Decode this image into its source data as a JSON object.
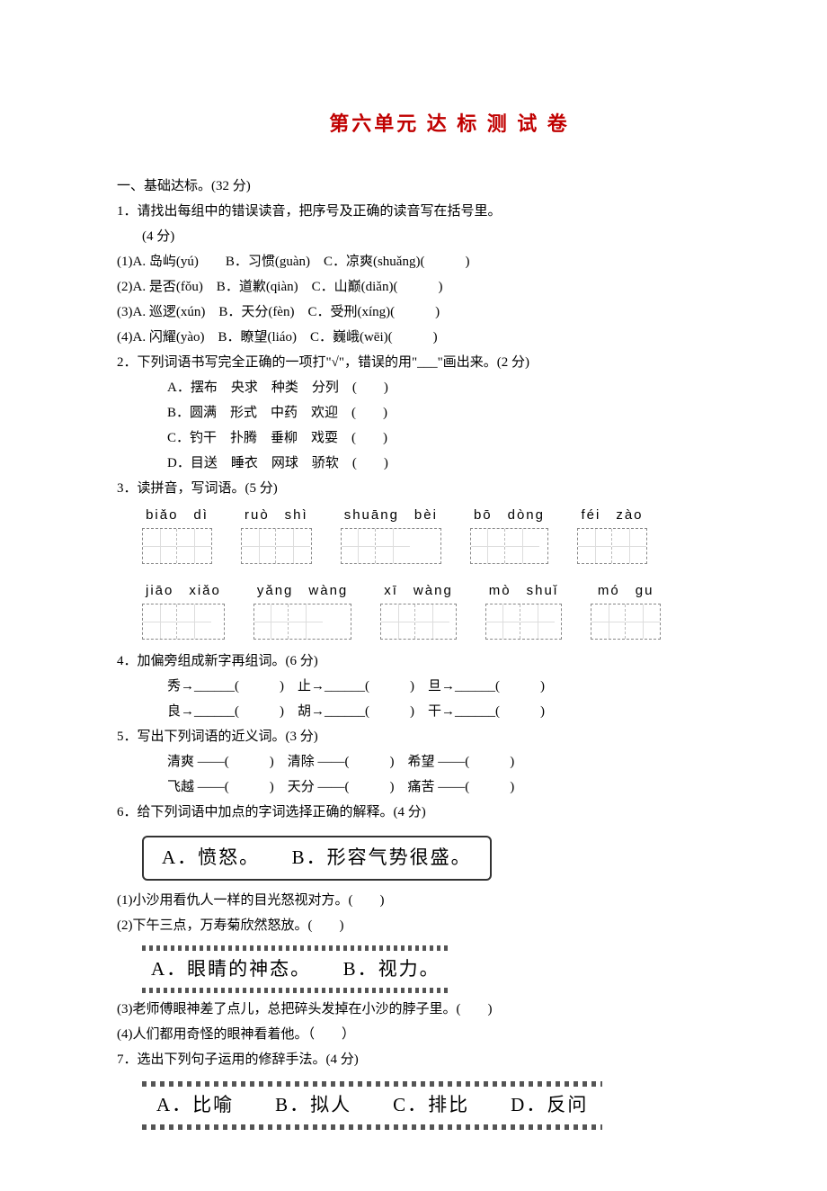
{
  "title": "第六单元 达 标 测 试 卷",
  "section1": {
    "header": "一、基础达标。(32 分)",
    "q1": {
      "stem": "1．请找出每组中的错误读音，把序号及正确的读音写在括号里。",
      "pts": "(4 分)",
      "rows": [
        "(1)A. 岛屿(yú)　　B．习惯(guàn)　C．凉爽(shuǎng)(　　　)",
        "(2)A. 是否(fǒu)　B．道歉(qiàn)　C．山巅(diǎn)(　　　)",
        "(3)A. 巡逻(xún)　B．天分(fèn)　C．受刑(xíng)(　　　)",
        "(4)A. 闪耀(yào)　B．瞭望(liáo)　C．巍峨(wēi)(　　　)"
      ]
    },
    "q2": {
      "stem": "2．下列词语书写完全正确的一项打\"√\"，错误的用\"___\"画出来。(2 分)",
      "opts": [
        "A．摆布　央求　种类　分列　(　　)",
        "B．圆满　形式　中药　欢迎　(　　)",
        "C．钓干　扑腾　垂柳　戏耍　(　　)",
        "D．目送　睡衣　网球　骄软　(　　)"
      ]
    },
    "q3": {
      "stem": "3．读拼音，写词语。(5 分)",
      "row1": [
        "biǎo　dì",
        "ruò　shì",
        "shuāng　bèi",
        "bō　dòng",
        "féi　zào"
      ],
      "row2": [
        "jiāo　xiǎo",
        "yǎng　wàng",
        "xī　wàng",
        "mò　shuǐ",
        "mó　gu"
      ]
    },
    "q4": {
      "stem": "4．加偏旁组成新字再组词。(6 分)",
      "rows": [
        "秀→______(　　　)　止→______(　　　)　旦→______(　　　)",
        "良→______(　　　)　胡→______(　　　)　干→______(　　　)"
      ]
    },
    "q5": {
      "stem": "5．写出下列词语的近义词。(3 分)",
      "rows": [
        "清爽 ——(　　　)　清除 ——(　　　)　希望 ——(　　　)",
        "飞越 ——(　　　)　天分 ——(　　　)　痛苦 ——(　　　)"
      ]
    },
    "q6": {
      "stem": "6．给下列词语中加点的字词选择正确的解释。(4 分)",
      "box1": "A．愤怒。　　B．形容气势很盛。",
      "items1": [
        "(1)小沙用看仇人一样的目光怒视对方。(　　)",
        "(2)下午三点，万寿菊欣然怒放。(　　)"
      ],
      "box2": "A．眼睛的神态。　　B．视力。",
      "items2": [
        "(3)老师傅眼神差了点儿，总把碎头发掉在小沙的脖子里。(　　)",
        "(4)人们都用奇怪的眼神看着他。（　　）"
      ]
    },
    "q7": {
      "stem": "7．选出下列句子运用的修辞手法。(4 分)",
      "box": "A．比喻　　B．拟人　　C．排比　　D．反问"
    }
  }
}
